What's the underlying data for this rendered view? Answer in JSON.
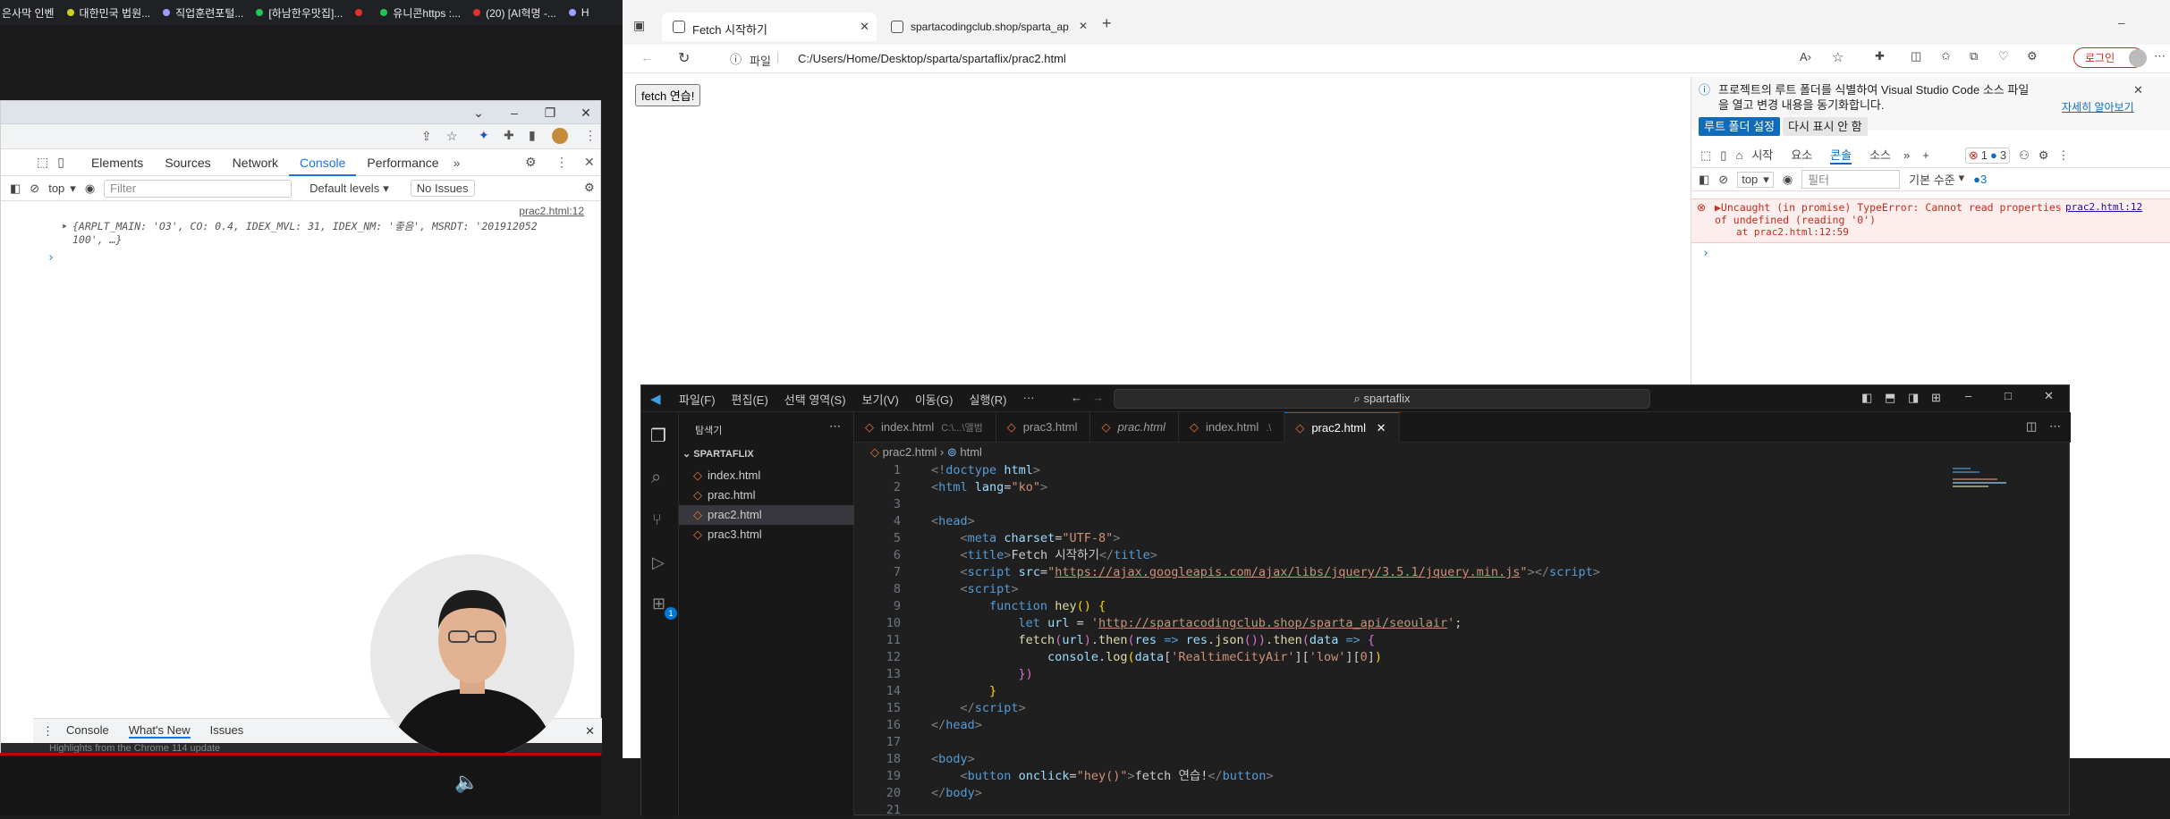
{
  "bookmarks": [
    {
      "label": "은사막 인벤",
      "color": "#d0c34a"
    },
    {
      "label": "대한민국 법원...",
      "color": "#cbd11c"
    },
    {
      "label": "직업훈련포털...",
      "color": "#9aa0ff"
    },
    {
      "label": "[하남한우맛집]...",
      "color": "#23c552"
    },
    {
      "label": "",
      "color": "#e0312d"
    },
    {
      "label": "유니콘https :...",
      "color": "#23c552"
    },
    {
      "label": "(20) [AI혁명 -...",
      "color": "#e0312d"
    },
    {
      "label": "H",
      "color": "#9aa0ff"
    }
  ],
  "chrome_devtools": {
    "tabs": [
      "Elements",
      "Sources",
      "Network",
      "Console",
      "Performance"
    ],
    "selected_tab": "Console",
    "more": "»",
    "context": "top",
    "filter_placeholder": "Filter",
    "levels": "Default levels",
    "issues": "No Issues",
    "source_link": "prac2.html:12",
    "log_line1": "{ARPLT_MAIN: 'O3', CO: 0.4, IDEX_MVL: 31, IDEX_NM: '좋음', MSRDT: '201912052",
    "log_line2": "100', …}",
    "prompt": "›",
    "drawer_tabs": [
      "Console",
      "What's New",
      "Issues"
    ],
    "drawer_selected": "What's New",
    "drawer_hint": "Highlights from the Chrome 114 update"
  },
  "edge": {
    "tabs": [
      {
        "label": "Fetch 시작하기",
        "active": true
      },
      {
        "label": "spartacodingclub.shop/sparta_ap",
        "active": false
      }
    ],
    "new_tab": "+",
    "address_prefix": "파일",
    "address": "C:/Users/Home/Desktop/sparta/spartaflix/prac2.html",
    "login_label": "로그인",
    "page_button": "fetch 연습!"
  },
  "edge_devtools": {
    "banner_text": "프로젝트의 루트 폴더를 식별하여 Visual Studio Code 소스 파일을 열고 변경 내용을 동기화합니다.",
    "learn_more": "자세히 알아보기",
    "btn_set_root": "루트 폴더 설정",
    "btn_dont_show": "다시 표시 안 함",
    "tabs": [
      "시작",
      "요소",
      "콘솔",
      "소스"
    ],
    "selected_tab": "콘솔",
    "error_count": "1",
    "info_count": "3",
    "context": "top",
    "filter_placeholder": "필터",
    "levels": "기본 수준",
    "issues_count": "3",
    "error_line1": "▶Uncaught (in promise) TypeError: Cannot read properties",
    "error_line2": "of undefined (reading '0')",
    "error_line3": "at prac2.html:12:59",
    "error_link": "prac2.html:12",
    "prompt": "›"
  },
  "vscode": {
    "menu": [
      "파일(F)",
      "편집(E)",
      "선택 영역(S)",
      "보기(V)",
      "이동(G)",
      "실행(R)",
      "···"
    ],
    "search": "spartaflix",
    "explorer_title": "탐색기",
    "folder": "SPARTAFLIX",
    "files": [
      "index.html",
      "prac.html",
      "prac2.html",
      "prac3.html"
    ],
    "selected_file": "prac2.html",
    "tabs": [
      {
        "label": "index.html",
        "hint": "C:\\...\\앨범"
      },
      {
        "label": "prac3.html",
        "hint": ""
      },
      {
        "label": "prac.html",
        "hint": ""
      },
      {
        "label": "index.html",
        "hint": ".\\"
      },
      {
        "label": "prac2.html",
        "hint": "",
        "active": true
      }
    ],
    "breadcrumb_file": "prac2.html",
    "breadcrumb_node": "html",
    "extensions_badge": "1",
    "line_numbers": [
      "1",
      "2",
      "3",
      "4",
      "5",
      "6",
      "7",
      "8",
      "9",
      "10",
      "11",
      "12",
      "13",
      "14",
      "15",
      "16",
      "17",
      "18",
      "19",
      "20",
      "21"
    ]
  }
}
